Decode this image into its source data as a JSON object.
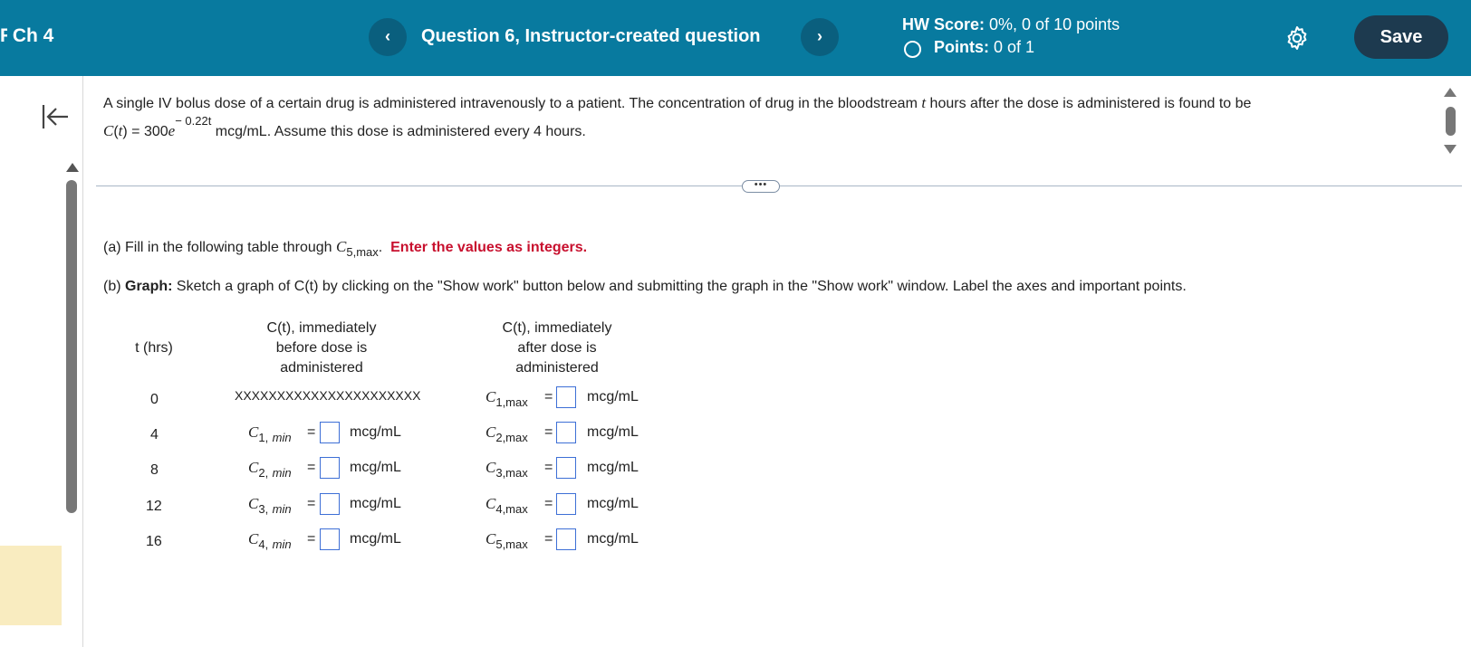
{
  "header": {
    "chapter": "Ch 4",
    "prev_icon": "‹",
    "next_icon": "›",
    "question_title": "Question 6, Instructor-created question",
    "hw_label": "HW Score:",
    "hw_value": "0%, 0 of 10 points",
    "points_label": "Points:",
    "points_value": "0 of 1",
    "save_label": "Save"
  },
  "problem": {
    "line1_a": "A single IV bolus dose of a certain drug is administered intravenously to a patient.  The concentration of drug in the bloodstream ",
    "var_t": "t",
    "line1_b": " hours after the dose is administered is found to be",
    "func_name": "C",
    "func_var": "t",
    "func_eq": " = 300",
    "base_e": "e",
    "exponent": "− 0.22t",
    "line2_b": " mcg/mL.  Assume this dose is administered every 4 hours."
  },
  "expand_dots": "•••",
  "part_a": {
    "prefix": "(a) Fill in the following table through ",
    "target_var": "C",
    "target_sub": "5,max",
    "suffix": ".",
    "instruction": "Enter the values as integers."
  },
  "part_b": {
    "prefix": "(b) ",
    "bold": "Graph:",
    "text": " Sketch a graph of  C(t) by clicking on the \"Show work\" button below and submitting the graph in the \"Show work\" window.  Label the axes and important points."
  },
  "table": {
    "col_t": "t (hrs)",
    "col_before": [
      "C(t), immediately",
      "before dose is",
      "administered"
    ],
    "col_after": [
      "C(t), immediately",
      "after dose is",
      "administered"
    ],
    "unit": "mcg/mL",
    "equals": "=",
    "var": "C",
    "rows": [
      {
        "t": "0",
        "before_placeholder": "XXXXXXXXXXXXXXXXXXXXXX",
        "before_sub": "",
        "after_sub": "1,max"
      },
      {
        "t": "4",
        "before_sub": "1,",
        "before_subi": "min",
        "after_sub": "2,max"
      },
      {
        "t": "8",
        "before_sub": "2,",
        "before_subi": "min",
        "after_sub": "3,max"
      },
      {
        "t": "12",
        "before_sub": "3,",
        "before_subi": "min",
        "after_sub": "4,max"
      },
      {
        "t": "16",
        "before_sub": "4,",
        "before_subi": "min",
        "after_sub": "5,max"
      }
    ]
  },
  "colors": {
    "topbar": "#087a9f",
    "nav_button": "#0a5f7e",
    "save_button": "#1d3a4f",
    "instruction_red": "#c8102e",
    "input_border": "#3d6fd6"
  }
}
